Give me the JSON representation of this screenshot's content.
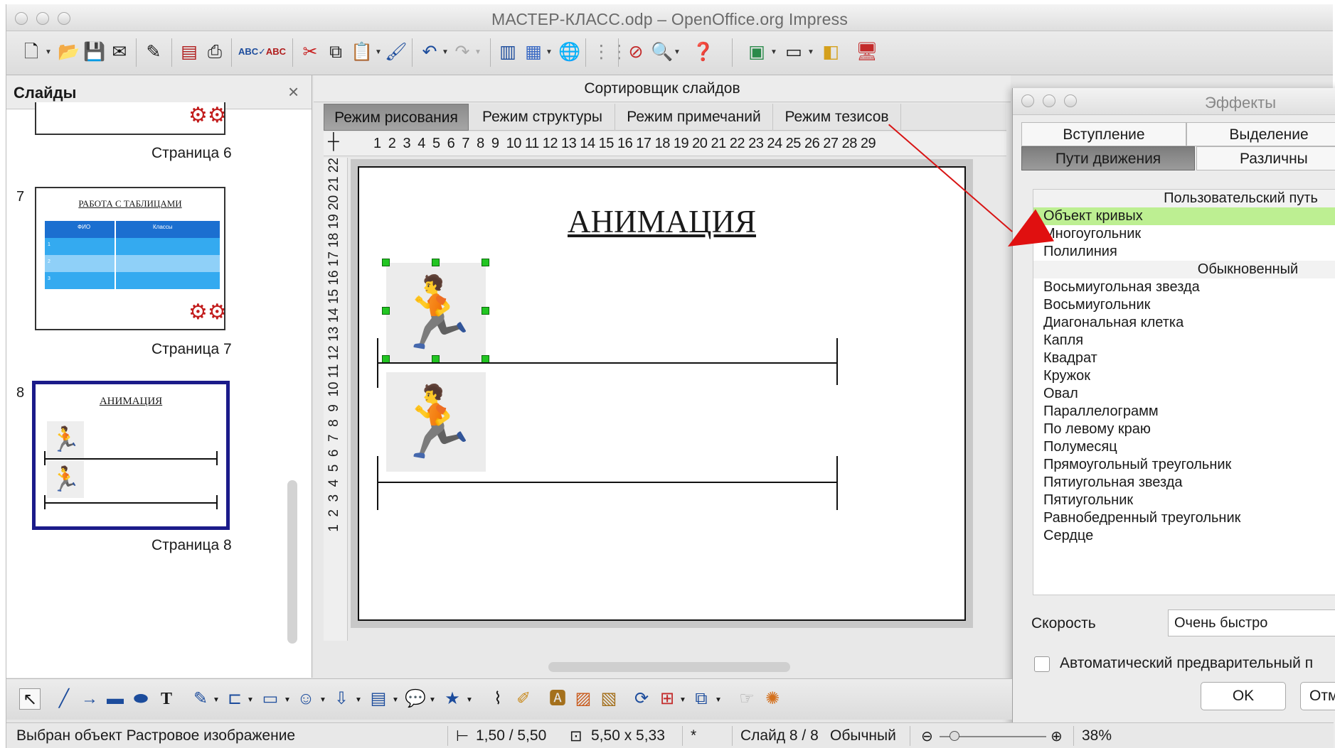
{
  "window": {
    "title": "МАСТЕР-КЛАСС.odp – OpenOffice.org Impress"
  },
  "toolbar": {
    "icons": [
      "new-icon",
      "open-icon",
      "save-icon",
      "email-icon",
      "edit-icon",
      "pdf-icon",
      "print-icon",
      "spellcheck-icon",
      "autospell-icon",
      "cut-icon",
      "copy-icon",
      "paste-icon",
      "format-paintbrush-icon",
      "undo-icon",
      "redo-icon",
      "chart-icon",
      "table-icon",
      "globe-icon",
      "grid-icon",
      "navigator-icon",
      "zoom-icon",
      "help-icon",
      "slide-layout-icon",
      "slide-design-icon",
      "display-icon",
      "presentation-icon"
    ]
  },
  "slides_pane": {
    "title": "Слайды",
    "close": "×",
    "slides": [
      {
        "num": "",
        "caption": "Страница 6"
      },
      {
        "num": "7",
        "caption": "Страница 7",
        "thumb_title": "РАБОТА С ТАБЛИЦАМИ",
        "table_headers": [
          "ФИО",
          "Классы"
        ],
        "table_rows": [
          "1",
          "2",
          "3"
        ]
      },
      {
        "num": "8",
        "caption": "Страница 8",
        "thumb_title": "АНИМАЦИЯ"
      }
    ]
  },
  "main": {
    "view_title": "Сортировщик слайдов",
    "tabs": [
      "Режим рисования",
      "Режим структуры",
      "Режим примечаний",
      "Режим тезисов"
    ],
    "ruler_h": "1  2  3  4  5  6  7  8  9  10 11 12 13 14 15 16 17 18 19 20 21 22 23 24 25 26 27 28 29",
    "ruler_v": "1  2  3  4  5  6  7  8  9  10 11 12 13 14 15 16 17 18 19 20 21 22",
    "slide_title": "АНИМАЦИЯ"
  },
  "effects": {
    "title": "Эффекты",
    "tabs_row1": [
      "Вступление",
      "Выделение"
    ],
    "tabs_row2": [
      "Пути движения",
      "Различны"
    ],
    "categories": [
      {
        "label": "Пользовательский путь",
        "items": [
          "Объект кривых",
          "Многоугольник",
          "Полилиния"
        ]
      },
      {
        "label": "Обыкновенный",
        "items": [
          "Восьмиугольная звезда",
          "Восьмиугольник",
          "Диагональная клетка",
          "Капля",
          "Квадрат",
          "Кружок",
          "Овал",
          "Параллелограмм",
          "По левому краю",
          "Полумесяц",
          "Прямоугольный треугольник",
          "Пятиугольная звезда",
          "Пятиугольник",
          "Равнобедренный треугольник",
          "Сердце"
        ]
      }
    ],
    "selected_item": "Объект кривых",
    "speed_label": "Скорость",
    "speed_value": "Очень быстро",
    "auto_preview_label": "Автоматический предварительный п",
    "auto_preview_checked": false,
    "ok_label": "OK",
    "cancel_label": "Отме"
  },
  "drawbar": {
    "icons": [
      "select-arrow-icon",
      "line-icon",
      "arrow-line-icon",
      "rectangle-icon",
      "ellipse-icon",
      "text-icon",
      "curve-icon",
      "connector-icon",
      "basic-shapes-icon",
      "symbol-shapes-icon",
      "block-arrows-icon",
      "flowchart-icon",
      "callouts-icon",
      "stars-icon",
      "points-icon",
      "glue-points-icon",
      "fontwork-icon",
      "from-file-icon",
      "gallery-icon",
      "rotate-icon",
      "align-icon",
      "arrange-icon",
      "extrusion-icon",
      "effects-icon"
    ]
  },
  "status": {
    "message": "Выбран объект Растровое изображение",
    "position": "1,50 / 5,50",
    "size": "5,50 x 5,33",
    "modified": "*",
    "slide": "Слайд 8 / 8",
    "layout": "Обычный",
    "zoom": "38%"
  }
}
